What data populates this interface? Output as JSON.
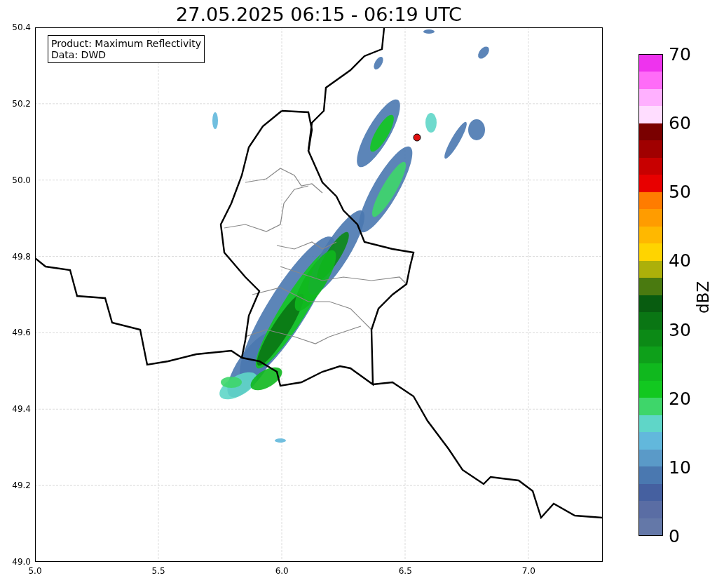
{
  "title": "27.05.2025 06:15 - 06:19 UTC",
  "info_box": [
    "Product: Maximum Reflectivity",
    "Data: DWD"
  ],
  "map": {
    "yticks": [
      "50.4",
      "50.2",
      "50.0",
      "49.8",
      "49.6",
      "49.4",
      "49.2",
      "49.0"
    ],
    "xticks": [
      "5.0",
      "5.5",
      "6.0",
      "6.5",
      "7.0"
    ],
    "marker": {
      "color": "#e01010"
    }
  },
  "colorbar": {
    "label": "dBZ",
    "ticks": [
      "70",
      "60",
      "50",
      "40",
      "30",
      "20",
      "10",
      "0"
    ],
    "segments": [
      {
        "color": "#ee33ee"
      },
      {
        "color": "#ff6cf8"
      },
      {
        "color": "#ffb0ff"
      },
      {
        "color": "#ffddff"
      },
      {
        "color": "#7a0000"
      },
      {
        "color": "#a00000"
      },
      {
        "color": "#c80000"
      },
      {
        "color": "#e80000"
      },
      {
        "color": "#ff7c00"
      },
      {
        "color": "#ff9c00"
      },
      {
        "color": "#ffb800"
      },
      {
        "color": "#ffd400"
      },
      {
        "color": "#acb00a"
      },
      {
        "color": "#4a7a10"
      },
      {
        "color": "#085c10"
      },
      {
        "color": "#0a7614"
      },
      {
        "color": "#0c8a16"
      },
      {
        "color": "#0ea01a"
      },
      {
        "color": "#10b81e"
      },
      {
        "color": "#12c820"
      },
      {
        "color": "#3ed66a"
      },
      {
        "color": "#5fd6c8"
      },
      {
        "color": "#62b8dc"
      },
      {
        "color": "#5a9ac8"
      },
      {
        "color": "#4a78b0"
      },
      {
        "color": "#4560a0"
      },
      {
        "color": "#5a6da4"
      },
      {
        "color": "#6478a8"
      }
    ]
  }
}
